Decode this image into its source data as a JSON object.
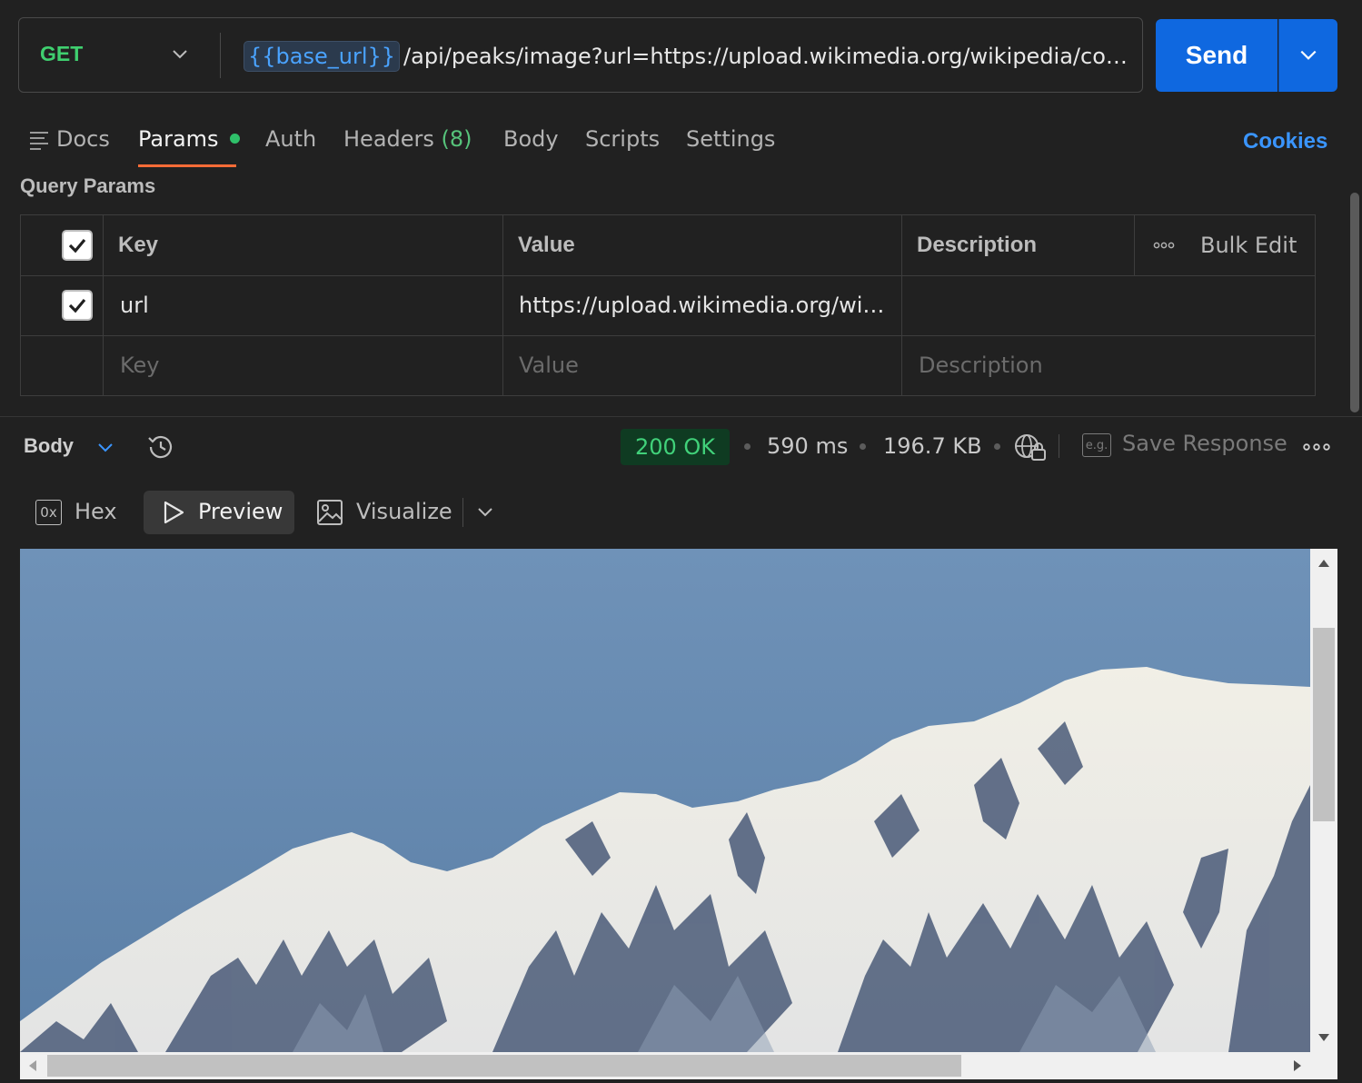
{
  "request": {
    "method": "GET",
    "url_variable": "{{base_url}}",
    "url_path": "/api/peaks/image?url=https://upload.wikimedia.org/wikipedia/commons…",
    "send_label": "Send"
  },
  "tabs": [
    {
      "label": "Docs"
    },
    {
      "label": "Params"
    },
    {
      "label": "Auth"
    },
    {
      "label": "Headers",
      "count": "(8)"
    },
    {
      "label": "Body"
    },
    {
      "label": "Scripts"
    },
    {
      "label": "Settings"
    }
  ],
  "cookies_label": "Cookies",
  "query_params": {
    "title": "Query Params",
    "headers": {
      "key": "Key",
      "value": "Value",
      "description": "Description",
      "bulk_edit": "Bulk Edit"
    },
    "rows": [
      {
        "key": "url",
        "value": "https://upload.wikimedia.org/wikip...",
        "description": "",
        "checked": true
      }
    ],
    "placeholder": {
      "key": "Key",
      "value": "Value",
      "description": "Description"
    }
  },
  "response": {
    "body_label": "Body",
    "status": "200 OK",
    "time": "590 ms",
    "size": "196.7 KB",
    "save_label": "Save Response",
    "eg_label": "e.g.",
    "modes": {
      "hex": "Hex",
      "hex_icon": "0x",
      "preview": "Preview",
      "visualize": "Visualize"
    }
  },
  "colors": {
    "method": "#3fcf6f",
    "send": "#0f68e0",
    "status_ok": "#41d17a",
    "accent": "#ff6c37",
    "link": "#3a95ff"
  }
}
